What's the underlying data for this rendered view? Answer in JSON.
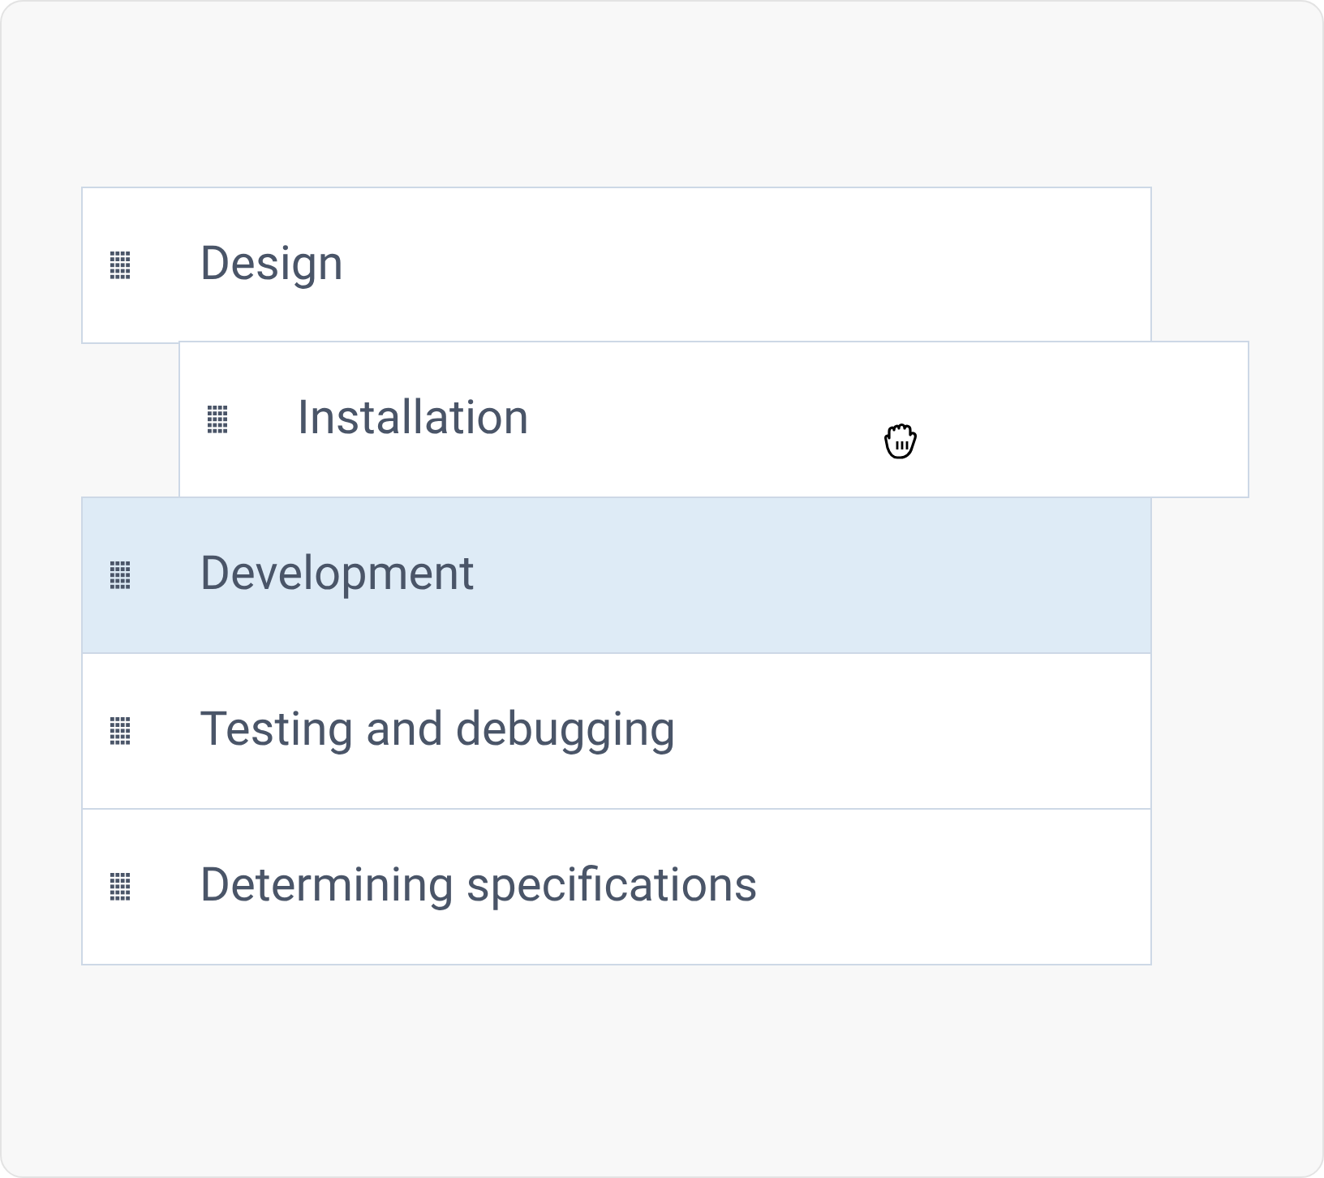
{
  "items": [
    {
      "label": "Design",
      "kind": "item",
      "selected": false
    },
    {
      "label": "Installation",
      "kind": "dragging",
      "selected": false
    },
    {
      "label": "Development",
      "kind": "item",
      "selected": true
    },
    {
      "label": "Testing and debugging",
      "kind": "item",
      "selected": false
    },
    {
      "label": "Determining specifications",
      "kind": "item",
      "selected": false
    }
  ]
}
